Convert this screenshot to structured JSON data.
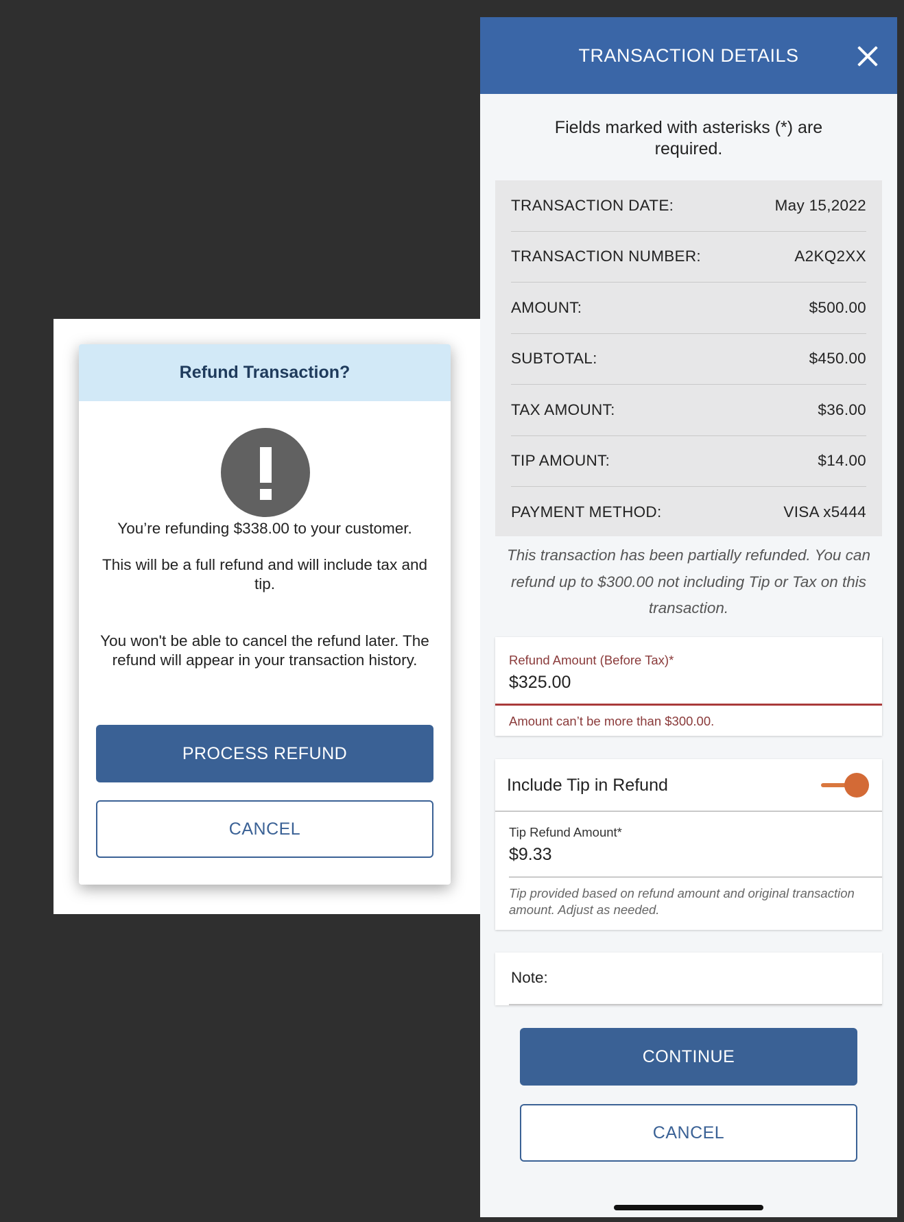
{
  "refund_dialog": {
    "title": "Refund Transaction?",
    "icon": "alert-exclamation-icon",
    "message_amount": "You’re refunding $338.00 to your customer.",
    "message_full_refund": "This will be a full refund and will include tax and tip.",
    "message_warning": "You won't be able to cancel the refund later. The refund will appear in your transaction history.",
    "process_button": "PROCESS REFUND",
    "cancel_button": "CANCEL"
  },
  "details_panel": {
    "title": "TRANSACTION DETAILS",
    "required_note": "Fields marked with asterisks (*) are required.",
    "rows": [
      {
        "label": "TRANSACTION DATE:",
        "value": "May 15,2022"
      },
      {
        "label": "TRANSACTION NUMBER:",
        "value": "A2KQ2XX"
      },
      {
        "label": "AMOUNT:",
        "value": "$500.00"
      },
      {
        "label": "SUBTOTAL:",
        "value": "$450.00"
      },
      {
        "label": "TAX AMOUNT:",
        "value": "$36.00"
      },
      {
        "label": "TIP AMOUNT:",
        "value": "$14.00"
      },
      {
        "label": "PAYMENT METHOD:",
        "value": "VISA x5444"
      }
    ],
    "partial_note": "This transaction has been partially refunded. You can refund up to $300.00 not including Tip or Tax on this transaction.",
    "refund_amount": {
      "label": "Refund Amount (Before Tax)*",
      "value": "$325.00",
      "error": "Amount can’t be more than $300.00."
    },
    "tip": {
      "toggle_label": "Include Tip in Refund",
      "toggle_on": true,
      "amount_label": "Tip Refund Amount*",
      "amount_value": "$9.33",
      "helper": "Tip provided based on refund amount and original transaction amount. Adjust as needed."
    },
    "note_label": "Note:",
    "continue_button": "CONTINUE",
    "cancel_button": "CANCEL"
  },
  "colors": {
    "primary": "#3a6195",
    "header_blue": "#3a66a7",
    "dialog_header": "#d2e9f7",
    "error": "#a93a3a",
    "toggle": "#d36a36"
  }
}
